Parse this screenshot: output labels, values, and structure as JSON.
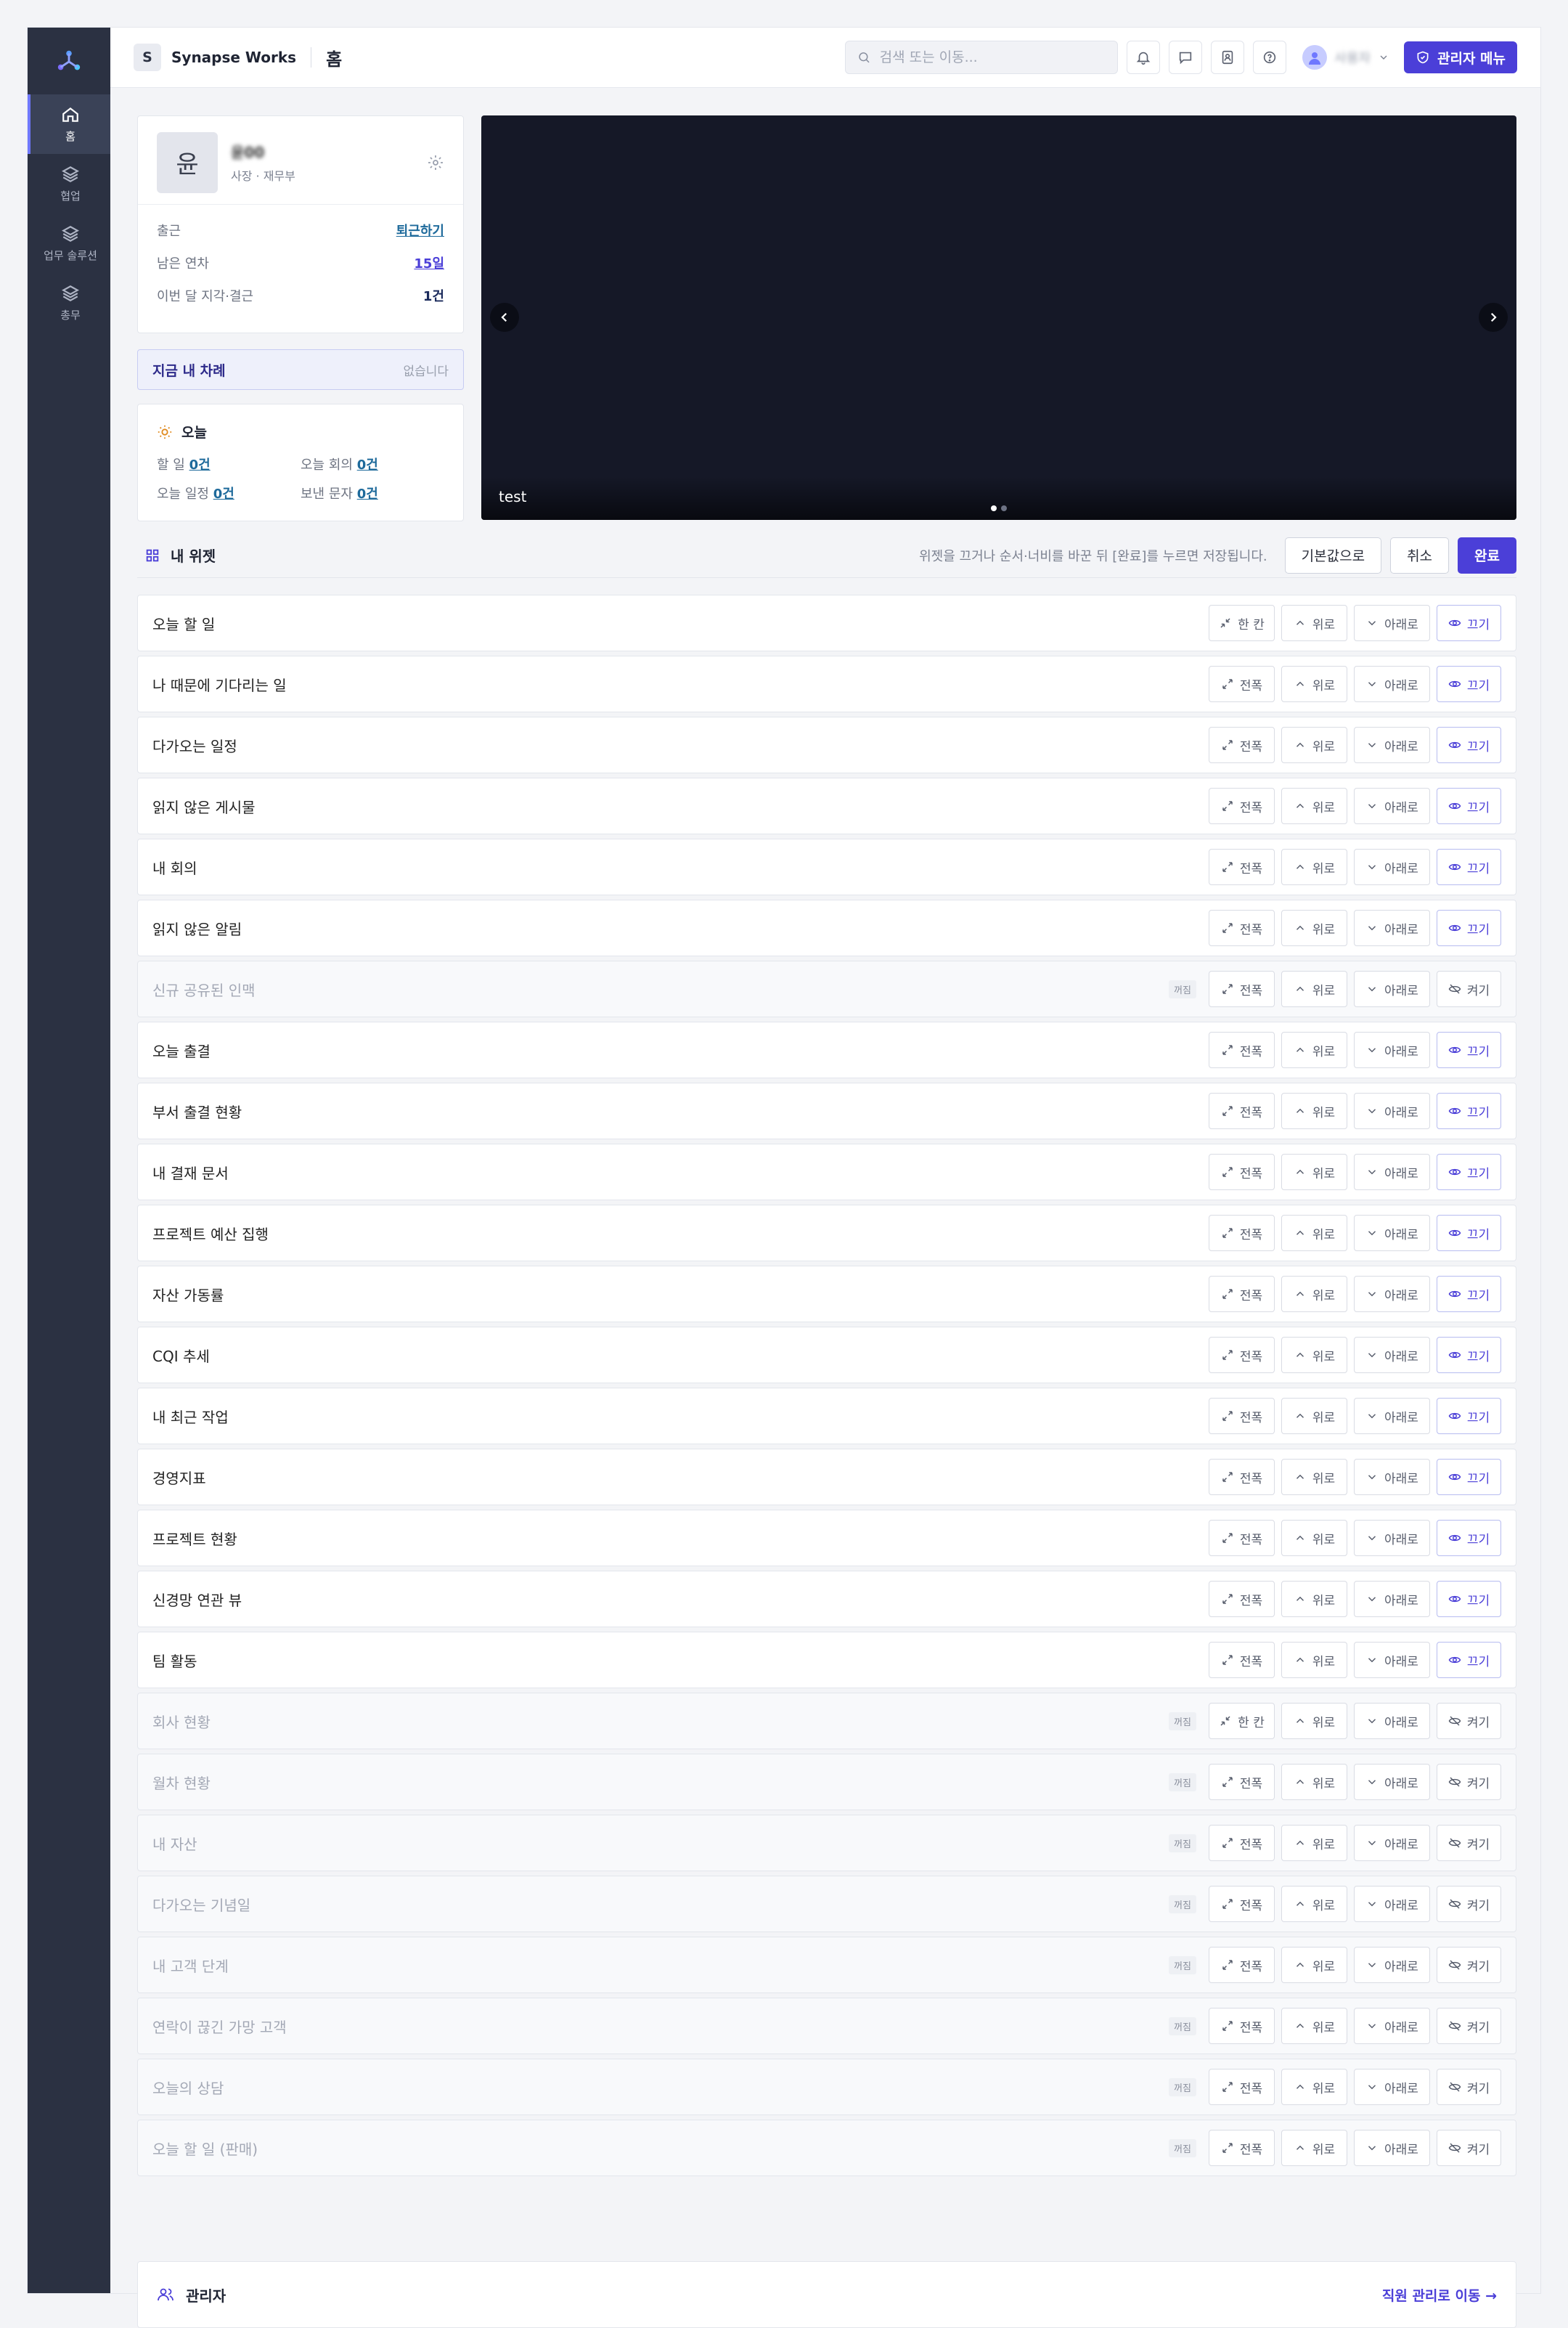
{
  "sidebar": {
    "items": [
      {
        "label": "홈",
        "icon": "home-icon",
        "active": true
      },
      {
        "label": "협업",
        "icon": "layers-icon"
      },
      {
        "label": "업무 솔루션",
        "icon": "layers-icon"
      },
      {
        "label": "총무",
        "icon": "layers-icon"
      }
    ]
  },
  "topbar": {
    "workspace_badge": "S",
    "workspace_name": "Synapse Works",
    "page_title": "홈",
    "search_placeholder": "검색 또는 이동...",
    "user_name": "사용자",
    "admin_menu": "관리자 메뉴"
  },
  "profile": {
    "initial": "윤",
    "name": "윤00",
    "role": "사장 · 재무부",
    "rows": [
      {
        "label": "출근",
        "value": "퇴근하기"
      },
      {
        "label": "남은 연차",
        "value": "15일"
      },
      {
        "label": "이번 달 지각·결근",
        "value": "1건"
      }
    ]
  },
  "turn": {
    "title": "지금 내 차례",
    "status": "없습니다"
  },
  "today": {
    "title": "오늘",
    "items": [
      {
        "label": "할 일",
        "value": "0건"
      },
      {
        "label": "오늘 회의",
        "value": "0건"
      },
      {
        "label": "오늘 일정",
        "value": "0건"
      },
      {
        "label": "보낸 문자",
        "value": "0건"
      }
    ]
  },
  "banner": {
    "caption": "test"
  },
  "widgets_header": {
    "title": "내 위젯",
    "hint": "위젯을 끄거나 순서·너비를 바꾼 뒤 [완료]를 누르면 저장됩니다.",
    "reset": "기본값으로",
    "cancel": "취소",
    "done": "완료"
  },
  "labels": {
    "up": "위로",
    "down": "아래로",
    "hide": "끄기",
    "show": "켜기",
    "off_tag": "꺼짐"
  },
  "widgets": [
    {
      "name": "오늘 할 일",
      "on": true,
      "width": "한 칸"
    },
    {
      "name": "나 때문에 기다리는 일",
      "on": true,
      "width": "전폭"
    },
    {
      "name": "다가오는 일정",
      "on": true,
      "width": "전폭"
    },
    {
      "name": "읽지 않은 게시물",
      "on": true,
      "width": "전폭"
    },
    {
      "name": "내 회의",
      "on": true,
      "width": "전폭"
    },
    {
      "name": "읽지 않은 알림",
      "on": true,
      "width": "전폭"
    },
    {
      "name": "신규 공유된 인맥",
      "on": false,
      "width": "전폭"
    },
    {
      "name": "오늘 출결",
      "on": true,
      "width": "전폭"
    },
    {
      "name": "부서 출결 현황",
      "on": true,
      "width": "전폭"
    },
    {
      "name": "내 결재 문서",
      "on": true,
      "width": "전폭"
    },
    {
      "name": "프로젝트 예산 집행",
      "on": true,
      "width": "전폭"
    },
    {
      "name": "자산 가동률",
      "on": true,
      "width": "전폭"
    },
    {
      "name": "CQI 추세",
      "on": true,
      "width": "전폭"
    },
    {
      "name": "내 최근 작업",
      "on": true,
      "width": "전폭"
    },
    {
      "name": "경영지표",
      "on": true,
      "width": "전폭"
    },
    {
      "name": "프로젝트 현황",
      "on": true,
      "width": "전폭"
    },
    {
      "name": "신경망 연관 뷰",
      "on": true,
      "width": "전폭"
    },
    {
      "name": "팀 활동",
      "on": true,
      "width": "전폭"
    },
    {
      "name": "회사 현황",
      "on": false,
      "width": "한 칸"
    },
    {
      "name": "월차 현황",
      "on": false,
      "width": "전폭"
    },
    {
      "name": "내 자산",
      "on": false,
      "width": "전폭"
    },
    {
      "name": "다가오는 기념일",
      "on": false,
      "width": "전폭"
    },
    {
      "name": "내 고객 단계",
      "on": false,
      "width": "전폭"
    },
    {
      "name": "연락이 끊긴 가망 고객",
      "on": false,
      "width": "전폭"
    },
    {
      "name": "오늘의 상담",
      "on": false,
      "width": "전폭"
    },
    {
      "name": "오늘 할 일 (판매)",
      "on": false,
      "width": "전폭"
    }
  ],
  "admin": {
    "title": "관리자",
    "link": "직원 관리로 이동 →"
  },
  "colors": {
    "accent": "#4b3fd8",
    "sidebar": "#2b3142",
    "link": "#1e6a9b"
  }
}
